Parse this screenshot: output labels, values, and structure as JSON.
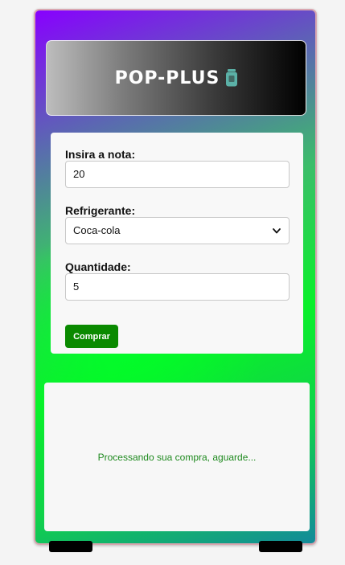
{
  "brand": {
    "title": "POP-PLUS",
    "icon": "soda-can-icon",
    "icon_color": "#5bb1a7"
  },
  "form": {
    "note_label": "Insira a nota:",
    "note_value": "20",
    "soda_label": "Refrigerante:",
    "soda_selected": "Coca-cola",
    "quantity_label": "Quantidade:",
    "quantity_value": "5",
    "buy_label": "Comprar"
  },
  "output": {
    "status": "Processando sua compra, aguarde..."
  },
  "colors": {
    "button": "#0a8a00",
    "status_text": "#1f8a1f"
  }
}
